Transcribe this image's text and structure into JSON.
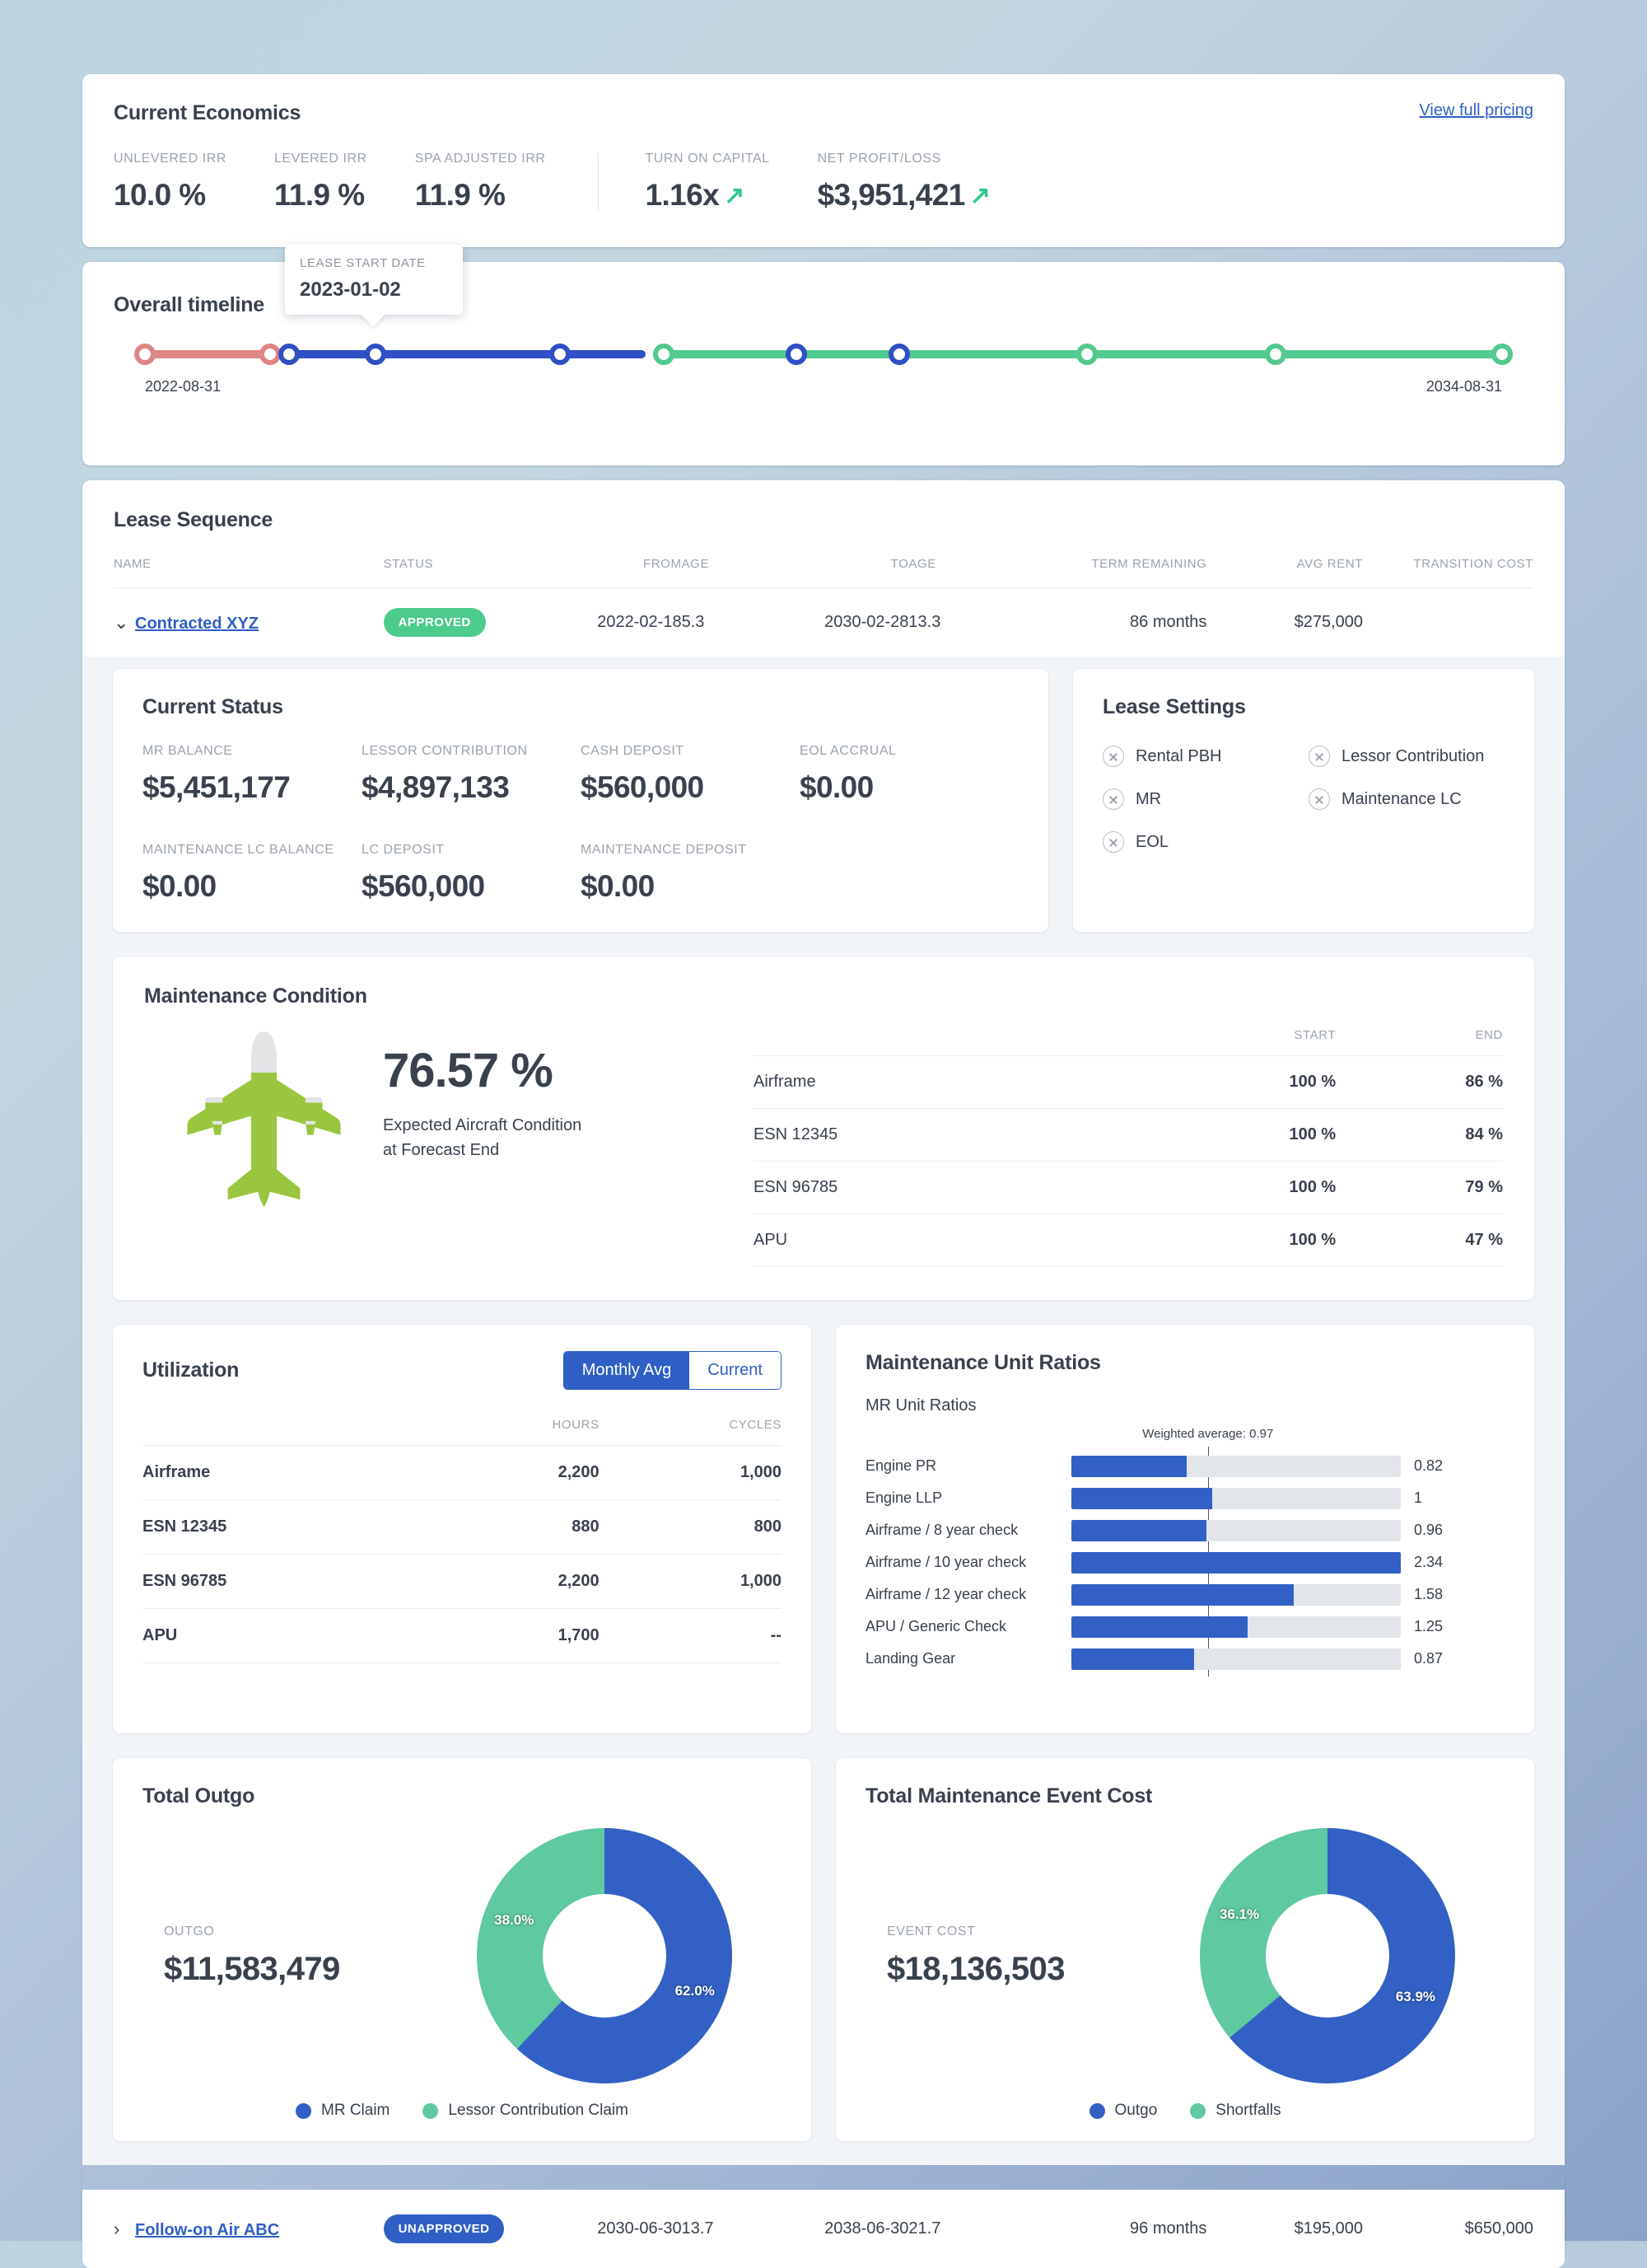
{
  "economics": {
    "title": "Current Economics",
    "link": "View full pricing",
    "group1": [
      {
        "label": "UNLEVERED IRR",
        "value": "10.0 %"
      },
      {
        "label": "LEVERED IRR",
        "value": "11.9 %"
      },
      {
        "label": "SPA ADJUSTED IRR",
        "value": "11.9 %"
      }
    ],
    "group2": [
      {
        "label": "TURN ON CAPITAL",
        "value": "1.16x",
        "trend": "↗"
      },
      {
        "label": "NET PROFIT/LOSS",
        "value": "$3,951,421",
        "trend": "↗"
      }
    ]
  },
  "timeline": {
    "title": "Overall timeline",
    "start_date": "2022-08-31",
    "end_date": "2034-08-31",
    "tooltip": {
      "label": "LEASE START DATE",
      "value": "2023-01-02"
    },
    "segments": [
      {
        "color": "#e08585",
        "start_pct": 0.0,
        "end_pct": 9.2
      },
      {
        "color": "#2f4fc4",
        "start_pct": 10.6,
        "end_pct": 36.9
      },
      {
        "color": "#52c98e",
        "start_pct": 38.2,
        "end_pct": 100.0
      }
    ],
    "markers": [
      {
        "pct": 0.0,
        "color": "#e08585"
      },
      {
        "pct": 9.2,
        "color": "#e08585"
      },
      {
        "pct": 10.6,
        "color": "#2f4fc4"
      },
      {
        "pct": 17.0,
        "color": "#2f4fc4"
      },
      {
        "pct": 30.6,
        "color": "#2f4fc4"
      },
      {
        "pct": 48.0,
        "color": "#2f4fc4"
      },
      {
        "pct": 55.6,
        "color": "#2f4fc4"
      },
      {
        "pct": 38.2,
        "color": "#52c98e"
      },
      {
        "pct": 69.4,
        "color": "#52c98e"
      },
      {
        "pct": 83.3,
        "color": "#52c98e"
      },
      {
        "pct": 100.0,
        "color": "#52c98e"
      }
    ]
  },
  "lease_sequence": {
    "title": "Lease Sequence",
    "columns": [
      "NAME",
      "STATUS",
      "FROM",
      "AGE",
      "TO",
      "AGE",
      "TERM REMAINING",
      "AVG RENT",
      "TRANSITION COST"
    ],
    "rows": [
      {
        "name": "Contracted XYZ",
        "status": "APPROVED",
        "status_kind": "approved",
        "from": "2022-02-18",
        "age_from": "5.3",
        "to": "2030-02-28",
        "age_to": "13.3",
        "term_remaining": "86 months",
        "avg_rent": "$275,000",
        "transition_cost": ""
      },
      {
        "name": "Follow-on Air ABC",
        "status": "UNAPPROVED",
        "status_kind": "unapproved",
        "from": "2030-06-30",
        "age_from": "13.7",
        "to": "2038-06-30",
        "age_to": "21.7",
        "term_remaining": "96 months",
        "avg_rent": "$195,000",
        "transition_cost": "$650,000"
      }
    ]
  },
  "current_status": {
    "title": "Current Status",
    "row1": [
      {
        "label": "MR BALANCE",
        "value": "$5,451,177"
      },
      {
        "label": "LESSOR CONTRIBUTION",
        "value": "$4,897,133"
      },
      {
        "label": "CASH DEPOSIT",
        "value": "$560,000"
      },
      {
        "label": "EOL ACCRUAL",
        "value": "$0.00"
      }
    ],
    "row2": [
      {
        "label": "MAINTENANCE LC BALANCE",
        "value": "$0.00"
      },
      {
        "label": "LC DEPOSIT",
        "value": "$560,000"
      },
      {
        "label": "MAINTENANCE DEPOSIT",
        "value": "$0.00"
      }
    ]
  },
  "lease_settings": {
    "title": "Lease Settings",
    "items": [
      {
        "label": "Rental PBH",
        "enabled": false
      },
      {
        "label": "Lessor Contribution",
        "enabled": false
      },
      {
        "label": "MR",
        "enabled": false
      },
      {
        "label": "Maintenance LC",
        "enabled": false
      },
      {
        "label": "EOL",
        "enabled": false
      }
    ]
  },
  "maintenance_condition": {
    "title": "Maintenance Condition",
    "percent": "76.57 %",
    "percent_value": 76.57,
    "caption_line1": "Expected Aircraft Condition",
    "caption_line2": "at Forecast End",
    "columns": [
      "",
      "START",
      "END"
    ],
    "rows": [
      {
        "name": "Airframe",
        "start": "100 %",
        "end": "86 %"
      },
      {
        "name": "ESN 12345",
        "start": "100 %",
        "end": "84 %"
      },
      {
        "name": "ESN 96785",
        "start": "100 %",
        "end": "79 %"
      },
      {
        "name": "APU",
        "start": "100 %",
        "end": "47 %"
      }
    ]
  },
  "utilization": {
    "title": "Utilization",
    "toggle": {
      "left": "Monthly Avg",
      "right": "Current",
      "active": "Monthly Avg"
    },
    "columns": [
      "",
      "HOURS",
      "CYCLES"
    ],
    "rows": [
      {
        "name": "Airframe",
        "hours": "2,200",
        "cycles": "1,000"
      },
      {
        "name": "ESN 12345",
        "hours": "880",
        "cycles": "800"
      },
      {
        "name": "ESN 96785",
        "hours": "2,200",
        "cycles": "1,000"
      },
      {
        "name": "APU",
        "hours": "1,700",
        "cycles": "--"
      }
    ]
  },
  "chart_data": [
    {
      "type": "bar",
      "title": "Maintenance Unit Ratios",
      "subtitle": "MR Unit Ratios",
      "annotation": "Weighted average: 0.97",
      "weighted_average": 0.97,
      "orientation": "horizontal",
      "xlim": [
        0,
        2.34
      ],
      "grid": false,
      "categories": [
        "Engine PR",
        "Engine LLP",
        "Airframe / 8 year check",
        "Airframe / 10 year check",
        "Airframe / 12 year check",
        "APU / Generic Check",
        "Landing Gear"
      ],
      "values": [
        0.82,
        1,
        0.96,
        2.34,
        1.58,
        1.25,
        0.87
      ],
      "value_labels": [
        "0.82",
        "1",
        "0.96",
        "2.34",
        "1.58",
        "1.25",
        "0.87"
      ],
      "bar_color": "#3260c4",
      "track_color": "#e2e5e9"
    },
    {
      "type": "pie",
      "title": "Total Outgo",
      "metric_label": "OUTGO",
      "metric_value": "$11,583,479",
      "labels": [
        "MR Claim",
        "Lessor Contribution Claim"
      ],
      "values": [
        62.0,
        38.0
      ],
      "value_labels": [
        "62.0%",
        "38.0%"
      ],
      "colors": [
        "#3260c4",
        "#5fc9a0"
      ],
      "legend": "bottom"
    },
    {
      "type": "pie",
      "title": "Total Maintenance Event Cost",
      "metric_label": "EVENT COST",
      "metric_value": "$18,136,503",
      "labels": [
        "Outgo",
        "Shortfalls"
      ],
      "values": [
        63.9,
        36.1
      ],
      "value_labels": [
        "63.9%",
        "36.1%"
      ],
      "colors": [
        "#3260c4",
        "#5fc9a0"
      ],
      "legend": "bottom"
    }
  ]
}
